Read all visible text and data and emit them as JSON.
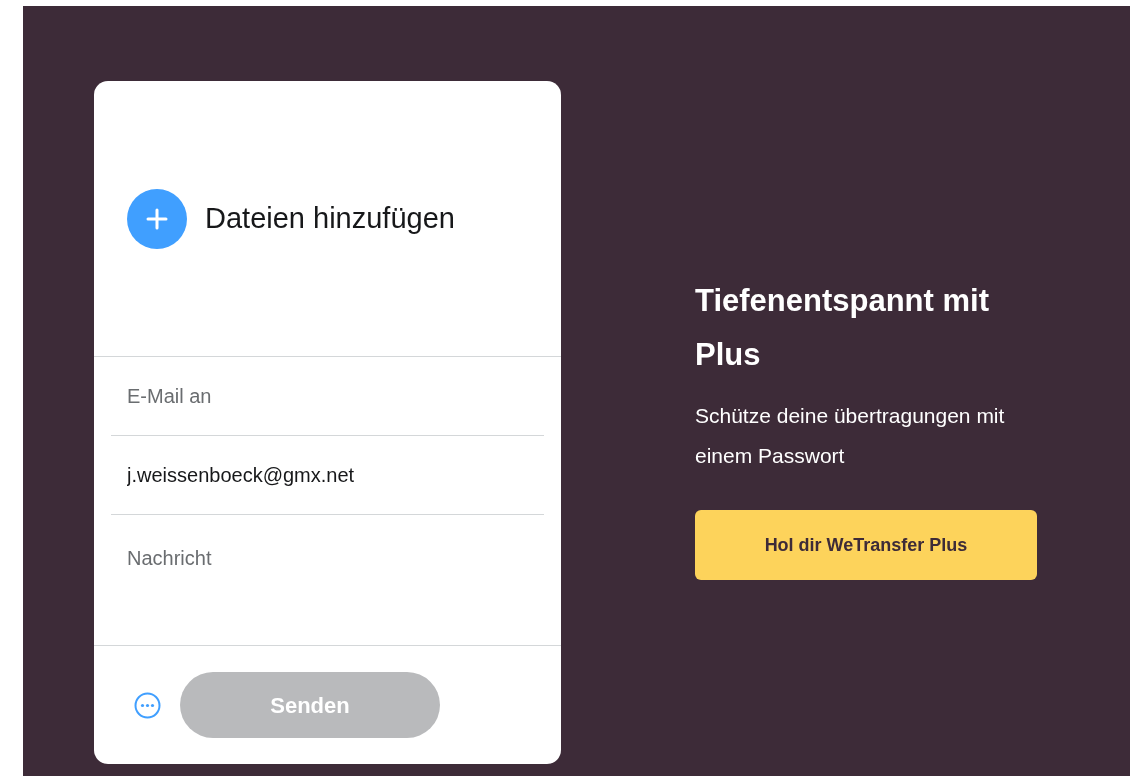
{
  "upload_card": {
    "add_files": {
      "label": "Dateien hinzufügen"
    },
    "fields": [
      {
        "kind": "line",
        "placeholder": "E-Mail an"
      },
      {
        "kind": "line",
        "value": "j.weissenboeck@gmx.net"
      },
      {
        "kind": "area",
        "placeholder": "Nachricht"
      }
    ],
    "send_button": {
      "label": "Senden",
      "disabled": true
    }
  },
  "promo": {
    "title": "Tiefenentspannt mit Plus",
    "text": "Schütze deine übertragungen mit einem Passwort",
    "button": "Hol dir WeTransfer Plus"
  }
}
